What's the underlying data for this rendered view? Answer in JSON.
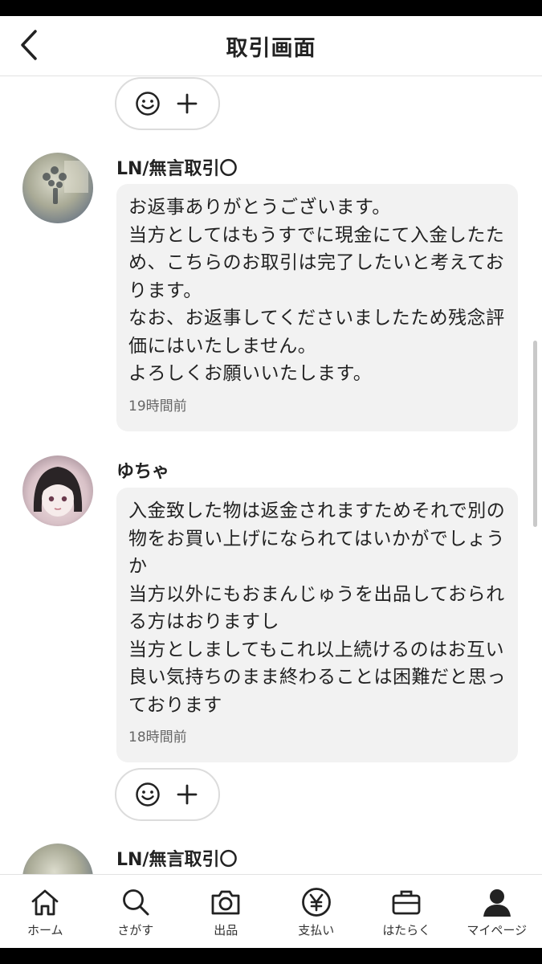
{
  "header": {
    "title": "取引画面",
    "back_icon": "chevron-left-icon"
  },
  "messages": [
    {
      "name": "LN/無言取引〇",
      "text": "お返事ありがとうございます。\n当方としてはもうすでに現金にて入金したため、こちらのお取引は完了したいと考えております。\nなお、お返事してくださいましたため残念評価にはいたしません。\nよろしくお願いいたします。",
      "time": "19時間前"
    },
    {
      "name": "ゆちゃ",
      "text": "入金致した物は返金されますためそれで別の物をお買い上げになられてはいかがでしょうか\n当方以外にもおまんじゅうを出品しておられる方はおりますし\n当方としましてもこれ以上続けるのはお互い良い気持ちのまま終わることは困難だと思っております",
      "time": "18時間前"
    },
    {
      "name": "LN/無言取引〇"
    }
  ],
  "reaction_bar": {
    "emoji_icon": "smiley-icon",
    "add_icon": "plus-icon"
  },
  "nav": {
    "items": [
      {
        "label": "ホーム",
        "icon": "home-icon"
      },
      {
        "label": "さがす",
        "icon": "search-icon"
      },
      {
        "label": "出品",
        "icon": "camera-icon"
      },
      {
        "label": "支払い",
        "icon": "yen-icon"
      },
      {
        "label": "はたらく",
        "icon": "briefcase-icon"
      },
      {
        "label": "マイページ",
        "icon": "person-icon"
      }
    ]
  }
}
